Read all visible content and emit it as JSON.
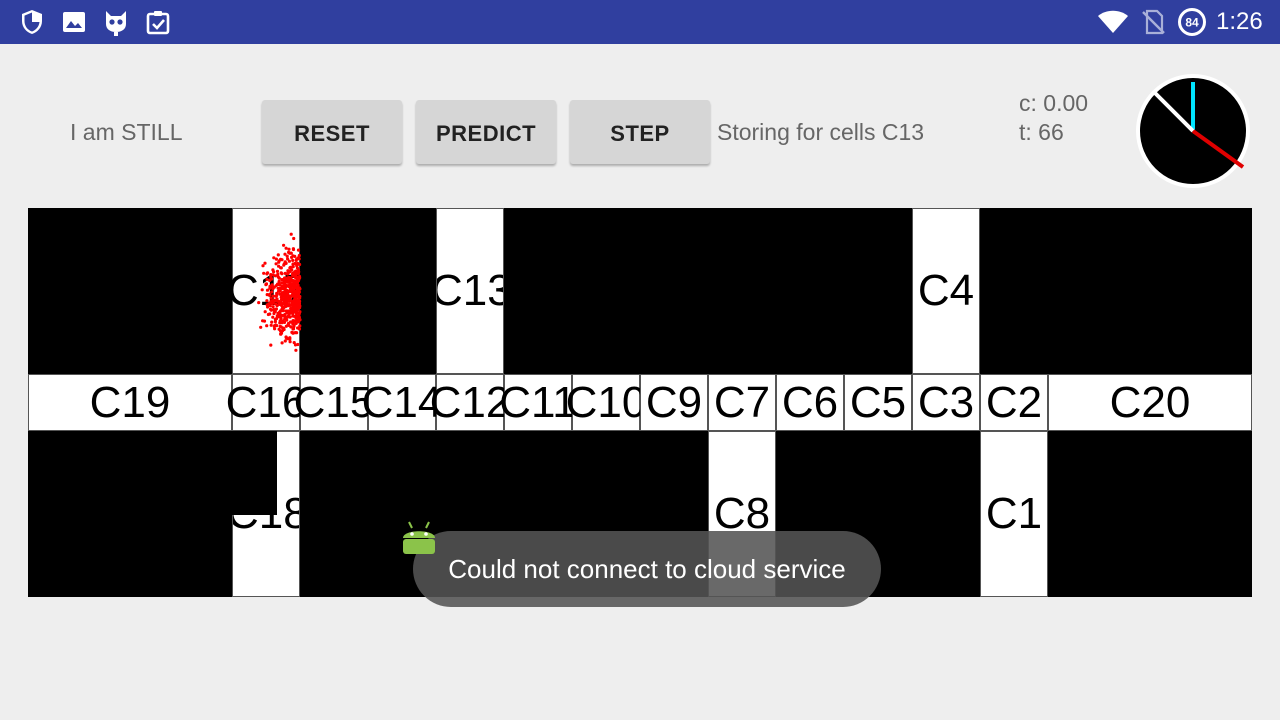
{
  "status_bar": {
    "icons": [
      "shield-icon",
      "image-icon",
      "cat-icon",
      "clipboard-check-icon"
    ],
    "right_icons": [
      "wifi-icon",
      "no-sim-icon",
      "battery-icon"
    ],
    "battery_level": "84",
    "time": "1:26"
  },
  "activity": {
    "text": "I am STILL"
  },
  "buttons": {
    "reset": "RESET",
    "predict": "PREDICT",
    "step": "STEP"
  },
  "storing": {
    "text": "Storing for cells C13"
  },
  "stats": {
    "c": "c: 0.00",
    "t": "t: 66"
  },
  "compass": {
    "icon": "compass-icon"
  },
  "map": {
    "cells": [
      {
        "id": "C17",
        "label": "C17"
      },
      {
        "id": "C13",
        "label": "C13"
      },
      {
        "id": "C4",
        "label": "C4"
      },
      {
        "id": "C19",
        "label": "C19"
      },
      {
        "id": "C16",
        "label": "C16"
      },
      {
        "id": "C15",
        "label": "C15"
      },
      {
        "id": "C14",
        "label": "C14"
      },
      {
        "id": "C12",
        "label": "C12"
      },
      {
        "id": "C11",
        "label": "C11"
      },
      {
        "id": "C10",
        "label": "C10"
      },
      {
        "id": "C9",
        "label": "C9"
      },
      {
        "id": "C7",
        "label": "C7"
      },
      {
        "id": "C6",
        "label": "C6"
      },
      {
        "id": "C5",
        "label": "C5"
      },
      {
        "id": "C3",
        "label": "C3"
      },
      {
        "id": "C2",
        "label": "C2"
      },
      {
        "id": "C20",
        "label": "C20"
      },
      {
        "id": "C18",
        "label": "C18"
      },
      {
        "id": "C8",
        "label": "C8"
      },
      {
        "id": "C1",
        "label": "C1"
      }
    ],
    "particle_color": "#ff0000"
  },
  "toast": {
    "text": "Could not connect to cloud service",
    "icon": "android-icon"
  }
}
